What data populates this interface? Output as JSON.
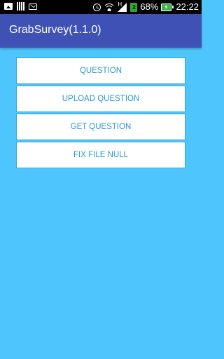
{
  "status_bar": {
    "icons_left": [
      "image-icon",
      "signal-bars-icon",
      "mail-icon"
    ],
    "icons_right": [
      "alarm-icon",
      "wifi-icon",
      "cell-signal-icon",
      "sim-2-icon",
      "battery-charging-icon"
    ],
    "net_type": "H",
    "sim_label": "2",
    "battery_percent": "68%",
    "time": "22:22"
  },
  "action_bar": {
    "title": "GrabSurvey(1.1.0)"
  },
  "menu": {
    "buttons": [
      {
        "label": "QUESTION"
      },
      {
        "label": "UPLOAD QUESTION"
      },
      {
        "label": "GET QUESTION"
      },
      {
        "label": "FIX FILE NULL"
      }
    ]
  },
  "colors": {
    "background": "#4ec6fd",
    "action_bar": "#3f51b5",
    "button_text": "#2b99d3",
    "button_border": "#3fa4d6",
    "battery_fill": "#39b54a"
  }
}
